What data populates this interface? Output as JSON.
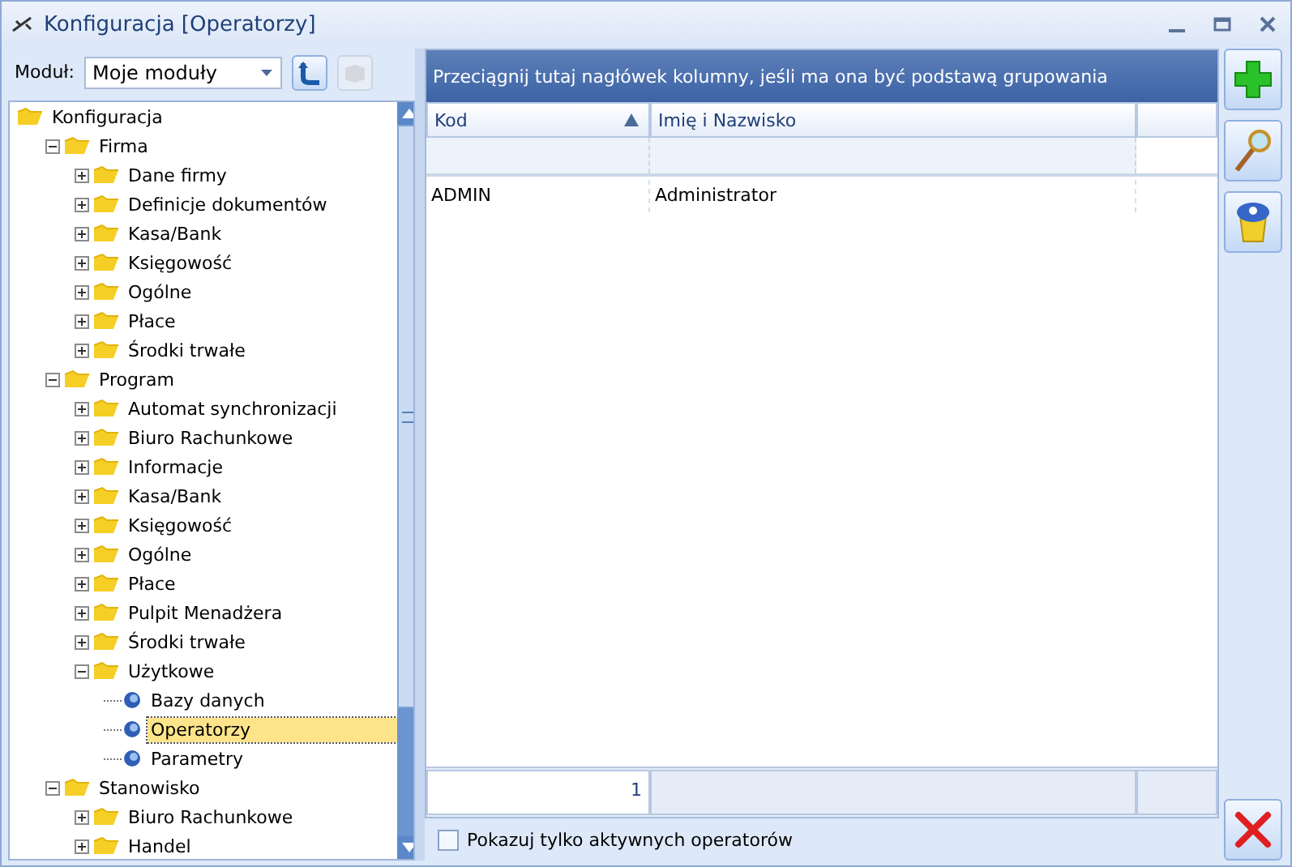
{
  "window": {
    "title": "Konfiguracja [Operatorzy]"
  },
  "module": {
    "label": "Moduł:",
    "value": "Moje moduły"
  },
  "tree": [
    {
      "label": "Konfiguracja",
      "kind": "folder",
      "children": [
        {
          "label": "Firma",
          "kind": "folder",
          "expanded": true,
          "children": [
            {
              "label": "Dane firmy",
              "kind": "folder",
              "expanded": false
            },
            {
              "label": "Definicje dokumentów",
              "kind": "folder",
              "expanded": false
            },
            {
              "label": "Kasa/Bank",
              "kind": "folder",
              "expanded": false
            },
            {
              "label": "Księgowość",
              "kind": "folder",
              "expanded": false
            },
            {
              "label": "Ogólne",
              "kind": "folder",
              "expanded": false
            },
            {
              "label": "Płace",
              "kind": "folder",
              "expanded": false
            },
            {
              "label": "Środki trwałe",
              "kind": "folder",
              "expanded": false
            }
          ]
        },
        {
          "label": "Program",
          "kind": "folder",
          "expanded": true,
          "children": [
            {
              "label": "Automat synchronizacji",
              "kind": "folder",
              "expanded": false
            },
            {
              "label": "Biuro Rachunkowe",
              "kind": "folder",
              "expanded": false
            },
            {
              "label": "Informacje",
              "kind": "folder",
              "expanded": false
            },
            {
              "label": "Kasa/Bank",
              "kind": "folder",
              "expanded": false
            },
            {
              "label": "Księgowość",
              "kind": "folder",
              "expanded": false
            },
            {
              "label": "Ogólne",
              "kind": "folder",
              "expanded": false
            },
            {
              "label": "Płace",
              "kind": "folder",
              "expanded": false
            },
            {
              "label": "Pulpit Menadżera",
              "kind": "folder",
              "expanded": false
            },
            {
              "label": "Środki trwałe",
              "kind": "folder",
              "expanded": false
            },
            {
              "label": "Użytkowe",
              "kind": "folder",
              "expanded": true,
              "children": [
                {
                  "label": "Bazy danych",
                  "kind": "item",
                  "selected": false
                },
                {
                  "label": "Operatorzy",
                  "kind": "item",
                  "selected": true
                },
                {
                  "label": "Parametry",
                  "kind": "item",
                  "selected": false
                }
              ]
            }
          ]
        },
        {
          "label": "Stanowisko",
          "kind": "folder",
          "expanded": true,
          "children": [
            {
              "label": "Biuro Rachunkowe",
              "kind": "folder",
              "expanded": false
            },
            {
              "label": "Handel",
              "kind": "folder",
              "expanded": false
            }
          ]
        }
      ]
    }
  ],
  "grid": {
    "group_hint": "Przeciągnij tutaj nagłówek kolumny, jeśli ma ona być podstawą grupowania",
    "columns": [
      {
        "label": "Kod",
        "sorted": true
      },
      {
        "label": "Imię i Nazwisko",
        "sorted": false
      }
    ],
    "rows": [
      [
        "ADMIN",
        "Administrator"
      ]
    ],
    "footer_count": "1"
  },
  "active_only": {
    "label": "Pokazuj tylko aktywnych operatorów",
    "checked": false
  }
}
